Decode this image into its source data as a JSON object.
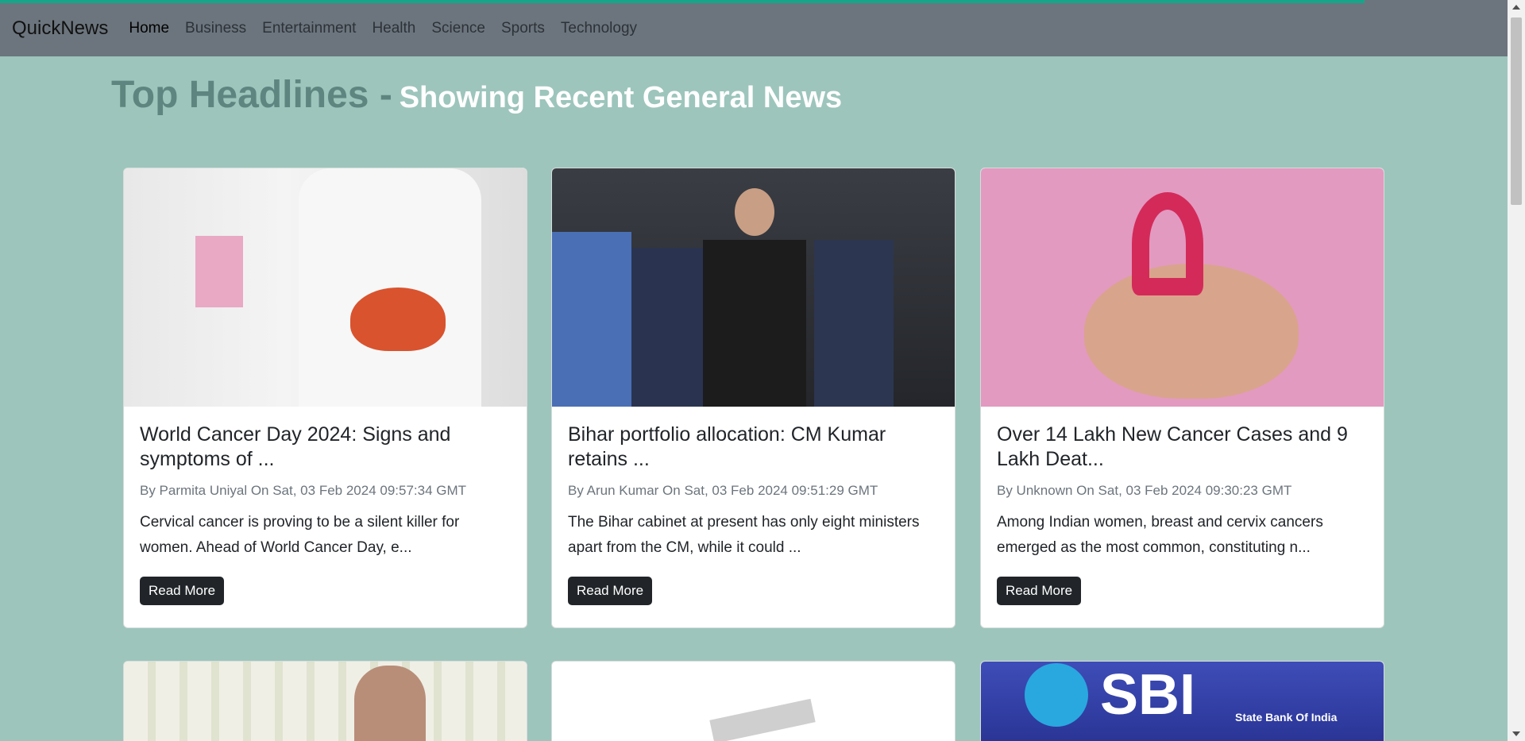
{
  "nav": {
    "brand": "QuickNews",
    "links": [
      "Home",
      "Business",
      "Entertainment",
      "Health",
      "Science",
      "Sports",
      "Technology"
    ]
  },
  "heading": {
    "main": "Top Headlines -",
    "sub": "Showing Recent General News"
  },
  "cards": [
    {
      "title": "World Cancer Day 2024: Signs and symptoms of ...",
      "meta": "By Parmita Uniyal On Sat, 03 Feb 2024 09:57:34 GMT",
      "desc": "Cervical cancer is proving to be a silent killer for women. Ahead of World Cancer Day, e...",
      "button": "Read More"
    },
    {
      "title": "Bihar portfolio allocation: CM Kumar retains ...",
      "meta": "By Arun Kumar On Sat, 03 Feb 2024 09:51:29 GMT",
      "desc": "The Bihar cabinet at present has only eight ministers apart from the CM, while it could ...",
      "button": "Read More"
    },
    {
      "title": "Over 14 Lakh New Cancer Cases and 9 Lakh Deat...",
      "meta": "By Unknown On Sat, 03 Feb 2024 09:30:23 GMT",
      "desc": "Among Indian women, breast and cervix cancers emerged as the most common, constituting n...",
      "button": "Read More"
    }
  ],
  "row2": {
    "sbi_logo": "SBI",
    "sbi_sub": "State Bank Of India"
  },
  "colors": {
    "nav": "#6c757d",
    "bg": "#9dc5bc",
    "accent": "#17a589"
  }
}
